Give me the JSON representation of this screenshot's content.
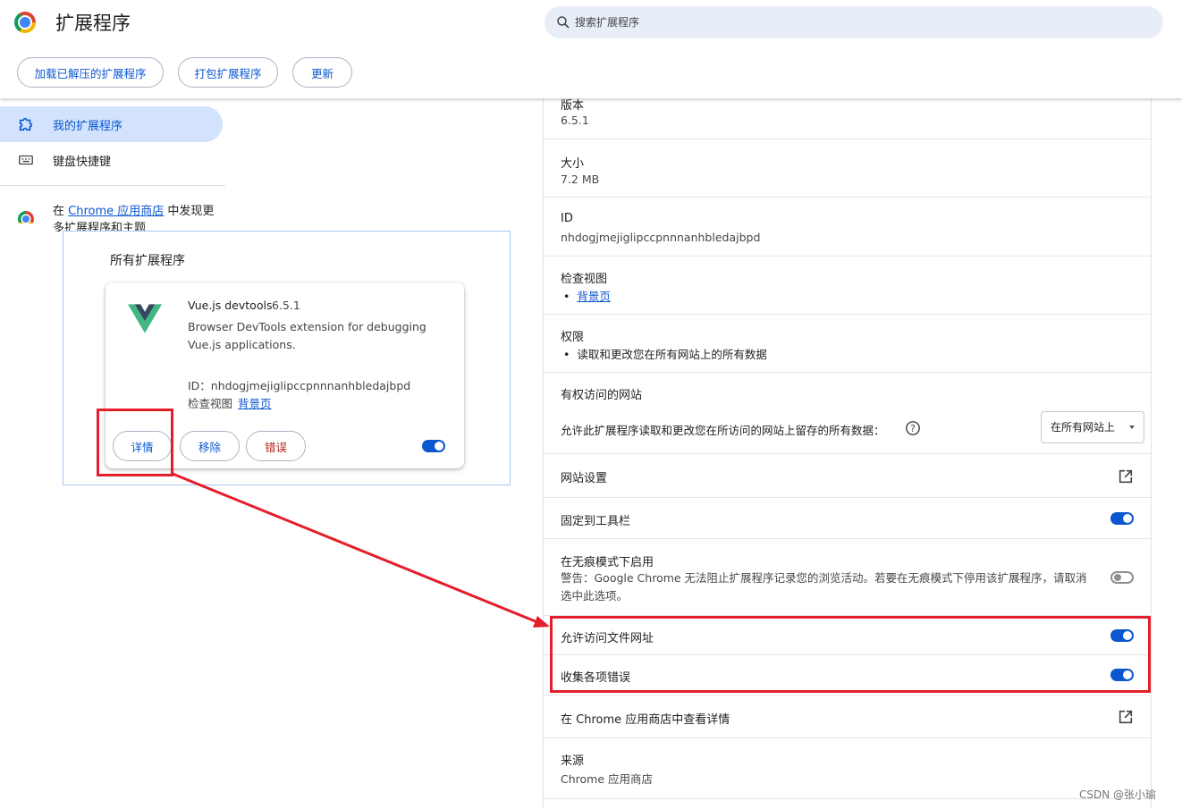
{
  "header": {
    "title": "扩展程序",
    "search_placeholder": "搜索扩展程序",
    "buttons": {
      "load_unpacked": "加载已解压的扩展程序",
      "pack": "打包扩展程序",
      "update": "更新"
    }
  },
  "sidebar": {
    "items": [
      {
        "label": "我的扩展程序",
        "icon": "puzzle-icon"
      },
      {
        "label": "键盘快捷键",
        "icon": "keyboard-icon"
      }
    ],
    "store_prefix": "在",
    "store_link": "Chrome 应用商店",
    "store_suffix": "中发现更多扩展程序和主题"
  },
  "popup": {
    "title": "所有扩展程序",
    "card": {
      "name": "Vue.js devtools",
      "version": "6.5.1",
      "description": "Browser DevTools extension for debugging Vue.js applications.",
      "id_line": "ID：nhdogjmejiglipccpnnnanhbledajbpd",
      "inspect_label": "检查视图",
      "inspect_link": "背景页",
      "buttons": {
        "details": "详情",
        "remove": "移除",
        "errors": "错误"
      },
      "enabled": true
    }
  },
  "details": {
    "version_label": "版本",
    "version_value": "6.5.1",
    "size_label": "大小",
    "size_value": "7.2 MB",
    "id_label": "ID",
    "id_value": "nhdogjmejiglipccpnnnanhbledajbpd",
    "inspect_label": "检查视图",
    "inspect_link": "背景页",
    "permissions_label": "权限",
    "permissions_item": "读取和更改您在所有网站上的所有数据",
    "site_access_label": "有权访问的网站",
    "site_access_desc": "允许此扩展程序读取和更改您在所访问的网站上留存的所有数据：",
    "site_access_select": "在所有网站上",
    "site_settings": "网站设置",
    "pin_toolbar": "固定到工具栏",
    "pin_toolbar_on": true,
    "incognito_label": "在无痕模式下启用",
    "incognito_warning": "警告：Google Chrome 无法阻止扩展程序记录您的浏览活动。若要在无痕模式下停用该扩展程序，请取消选中此选项。",
    "incognito_on": false,
    "file_urls": "允许访问文件网址",
    "file_urls_on": true,
    "collect_errors": "收集各项错误",
    "collect_errors_on": true,
    "store_details": "在 Chrome 应用商店中查看详情",
    "source_label": "来源",
    "source_value": "Chrome 应用商店"
  },
  "watermark": "CSDN @张小瑜",
  "colors": {
    "accent": "#0b57d0",
    "annotation": "#e41e2b",
    "error": "#b3261e"
  }
}
